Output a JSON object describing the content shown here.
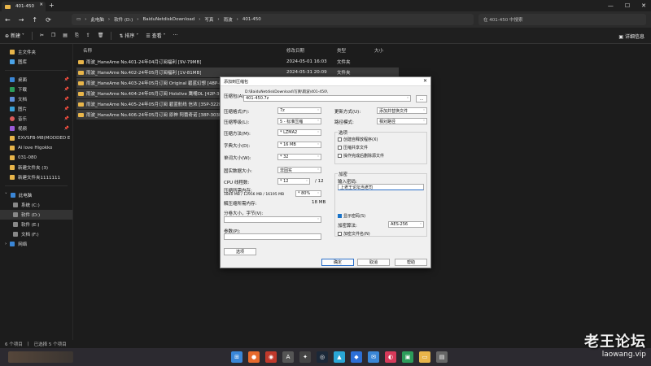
{
  "window": {
    "tab_title": "401-450",
    "tab_close": "✕",
    "new_tab": "+",
    "controls": [
      "—",
      "☐",
      "✕"
    ]
  },
  "nav": {
    "back": "←",
    "forward": "→",
    "up": "↑",
    "refresh": "⟳",
    "breadcrumb": [
      "此电脑",
      "软件 (D:)",
      "BaiduNetdiskDownload",
      "写真",
      "雨波",
      "401-450"
    ],
    "search_placeholder": "在 401-450 中搜索"
  },
  "toolbar": {
    "new_label": "新建",
    "sort_label": "排序",
    "view_label": "查看",
    "more": "···",
    "details_label": "详细信息"
  },
  "sidebar": {
    "items": [
      {
        "label": "主文件夹",
        "color": "#e8b54a",
        "pinned": false
      },
      {
        "label": "图库",
        "color": "#4aa3e8",
        "pinned": false
      },
      {
        "label": "桌面",
        "color": "#3a86d6",
        "pinned": true
      },
      {
        "label": "下载",
        "color": "#2c9c5a",
        "pinned": true
      },
      {
        "label": "文档",
        "color": "#5f8fd8",
        "pinned": true
      },
      {
        "label": "图片",
        "color": "#3aa0d8",
        "pinned": true
      },
      {
        "label": "音乐",
        "color": "#d85a5a",
        "pinned": true
      },
      {
        "label": "视频",
        "color": "#9a5ad8",
        "pinned": true
      },
      {
        "label": "EXVSFB-M8(MODDED E",
        "color": "#e8b54a",
        "pinned": true
      },
      {
        "label": "Ai love Higokko",
        "color": "#e8b54a",
        "pinned": false
      },
      {
        "label": "031-080",
        "color": "#e8b54a",
        "pinned": false
      },
      {
        "label": "新建文件夹 (3)",
        "color": "#e8b54a",
        "pinned": false
      },
      {
        "label": "新建文件夹1111111",
        "color": "#e8b54a",
        "pinned": false
      }
    ],
    "drives": [
      {
        "label": "此电脑",
        "color": "#3a86d6"
      },
      {
        "label": "系统 (C:)",
        "color": "#888888"
      },
      {
        "label": "软件 (D:)",
        "color": "#888888"
      },
      {
        "label": "软件 (E:)",
        "color": "#888888"
      },
      {
        "label": "文档 (F:)",
        "color": "#888888"
      },
      {
        "label": "网络",
        "color": "#3a86d6"
      }
    ],
    "pin_glyph": "📌"
  },
  "files": {
    "columns": {
      "name": "名称",
      "date": "修改日期",
      "type": "类型",
      "size": "大小"
    },
    "rows": [
      {
        "name": "雨波_HaneAme No.401-24年04月订阅福利 [9V-79MB]",
        "date": "2024-05-01 16:03",
        "type": "文件夹"
      },
      {
        "name": "雨波_HaneAme No.402-24年05月订阅福利 [1V-81MB]",
        "date": "2024-05-31 20:09",
        "type": "文件夹"
      },
      {
        "name": "雨波_HaneAme No.403-24年05月订阅 Original 碧蓝幻想 [48P-831MB]",
        "date": "",
        "type": ""
      },
      {
        "name": "雨波_HaneAme No.404-24年05月订阅 Hololive 鹰嘴OL [42P-346MB]",
        "date": "",
        "type": ""
      },
      {
        "name": "雨波_HaneAme No.405-24年05月订阅 碧蓝航线 信浓 [35P-322MB]",
        "date": "",
        "type": ""
      },
      {
        "name": "雨波_HaneAme No.406-24年05月订阅 原神 阿蕾奇诺 [38P-303MB]",
        "date": "",
        "type": ""
      }
    ]
  },
  "status": {
    "count": "6 个项目",
    "selected": "已选择 5 个项目"
  },
  "dialog": {
    "title": "添加到压缩包",
    "close": "✕",
    "archive_name_label": "压缩包(A):",
    "archive_path": "D:\\BaiduNetdiskDownload\\写真\\雨波\\401-450\\",
    "archive_name": "401-450.7z",
    "browse": "...",
    "format_label": "压缩格式(F):",
    "format_value": "7z",
    "level_label": "压缩等级(L):",
    "level_value": "5 - 标准压缩",
    "method_label": "压缩方法(M):",
    "method_value": "* LZMA2",
    "dict_label": "字典大小(D):",
    "dict_value": "* 16 MB",
    "word_label": "单词大小(W):",
    "word_value": "* 32",
    "solid_label": "固实数据大小:",
    "solid_value": "非固实",
    "cpu_label": "CPU 线程数:",
    "cpu_value": "* 12",
    "cpu_max": "/ 12",
    "mem_label": "压缩所需内存:",
    "mem_detail": "1840 MB / 12956 MB / 16195 MB",
    "mem_pct": "* 80%",
    "decomp_label": "解压缩所需内存:",
    "decomp_value": "18 MB",
    "split_label": "分卷大小，字节(V):",
    "params_label": "参数(P):",
    "options_button": "选项",
    "update_label": "更新方式(U):",
    "update_value": "添加并替换文件",
    "path_label": "路径模式:",
    "path_value": "相对路径",
    "opts_title": "选项",
    "opt_sfx": "创建自释放程序(X)",
    "opt_shared": "压缩共享文件",
    "opt_delete": "操作完成后删除源文件",
    "enc_title": "加密",
    "pwd_label": "输入密码:",
    "pwd_value": "上老王论坛当老司",
    "show_pwd": "显示密码(S)",
    "enc_method_label": "加密算法:",
    "enc_method_value": "AES-256",
    "enc_names": "加密文件名(N)",
    "ok": "确定",
    "cancel": "取消",
    "help": "帮助"
  },
  "watermark": {
    "line1": "老王论坛",
    "line2": "laowang.vip"
  },
  "taskbar": {
    "icons": [
      {
        "name": "start",
        "glyph": "⊞",
        "color": "#3a86d6"
      },
      {
        "name": "firefox",
        "glyph": "●",
        "color": "#e66a2c"
      },
      {
        "name": "app-a",
        "glyph": "◉",
        "color": "#c0392b"
      },
      {
        "name": "app-b",
        "glyph": "A",
        "color": "#555555"
      },
      {
        "name": "app-c",
        "glyph": "✦",
        "color": "#444444"
      },
      {
        "name": "steam",
        "glyph": "◎",
        "color": "#1b2838"
      },
      {
        "name": "app-d",
        "glyph": "▲",
        "color": "#2aa7d6"
      },
      {
        "name": "app-e",
        "glyph": "◆",
        "color": "#2c6fd6"
      },
      {
        "name": "app-f",
        "glyph": "✉",
        "color": "#3a86d6"
      },
      {
        "name": "app-g",
        "glyph": "◐",
        "color": "#d63a5a"
      },
      {
        "name": "app-h",
        "glyph": "▣",
        "color": "#2c9c5a"
      },
      {
        "name": "explorer",
        "glyph": "▭",
        "color": "#e8b54a"
      },
      {
        "name": "app-i",
        "glyph": "▤",
        "color": "#666666"
      }
    ]
  }
}
